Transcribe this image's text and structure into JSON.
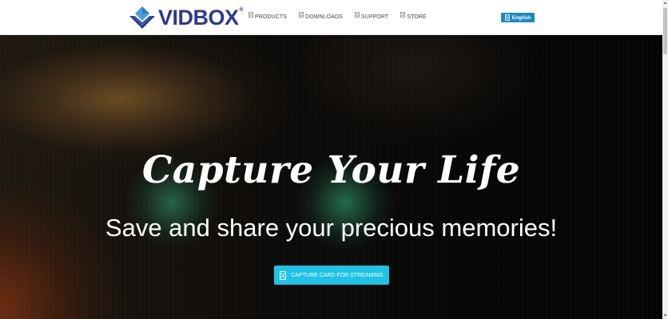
{
  "header": {
    "logo_text_part1": "VID",
    "logo_text_part2": "BOX",
    "logo_registered": "®",
    "nav": [
      {
        "label": "PRODUCTS",
        "icon": "broken-image-icon"
      },
      {
        "label": "DOWNLOADS",
        "icon": "broken-image-icon"
      },
      {
        "label": "SUPPORT",
        "icon": "broken-image-icon"
      },
      {
        "label": "STORE",
        "icon": "broken-image-icon"
      }
    ],
    "language_button": "English"
  },
  "hero": {
    "title": "Capture Your Life",
    "subtitle": "Save and share your precious memories!",
    "cta_label": "CAPTURE CARD FOR STREAMING"
  },
  "colors": {
    "brand_navy": "#2b3990",
    "brand_light_blue": "#4a9fd8",
    "language_button": "#1e88c9",
    "cta_button": "#1ec3e6"
  }
}
